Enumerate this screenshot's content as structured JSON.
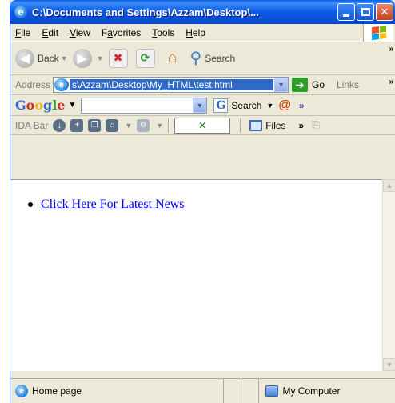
{
  "window": {
    "title": "C:\\Documents and Settings\\Azzam\\Desktop\\...",
    "min_label": "minimize",
    "max_label": "maximize",
    "close_label": "✕"
  },
  "menu": {
    "file": "F",
    "file_rest": "ile",
    "edit": "E",
    "edit_rest": "dit",
    "view": "V",
    "view_rest": "iew",
    "favorites_pre": "F",
    "favorites_u": "a",
    "favorites_rest": "vorites",
    "tools": "T",
    "tools_rest": "ools",
    "help": "H",
    "help_rest": "elp"
  },
  "toolbar": {
    "back_label": "Back",
    "search_label": "Search"
  },
  "address": {
    "label": "Address",
    "value": "s\\Azzam\\Desktop\\My_HTML\\test.html",
    "go_label": "Go",
    "links_label": "Links"
  },
  "google": {
    "logo": "Google",
    "search_label": "Search",
    "input_value": ""
  },
  "ida": {
    "label": "IDA Bar",
    "files_label": "Files"
  },
  "page": {
    "link_text": "Click Here For Latest News"
  },
  "status": {
    "left_text": "Home page",
    "zone_text": "My Computer"
  },
  "colors": {
    "titlebar": "#0b58e3",
    "link": "#0000ee",
    "chrome": "#ece9d8"
  }
}
